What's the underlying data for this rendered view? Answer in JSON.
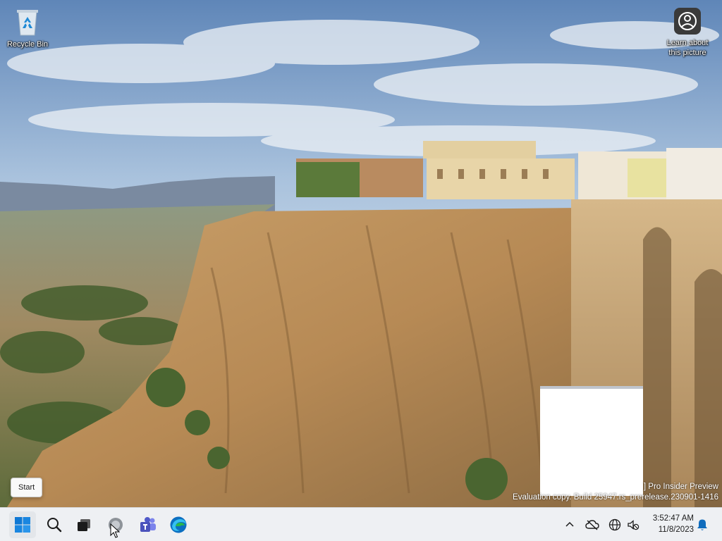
{
  "desktop": {
    "icons": [
      {
        "label": "Recycle Bin",
        "icon": "recycle-bin-icon"
      },
      {
        "label": "Learn about this picture",
        "icon": "info-icon"
      }
    ],
    "watermark": {
      "line1": "] Pro Insider Preview",
      "line2": "Evaluation copy. Build 25947.rs_prerelease.230901-1416"
    }
  },
  "tooltip": {
    "text": "Start"
  },
  "taskbar": {
    "apps": [
      {
        "name": "start",
        "icon": "windows-logo-icon"
      },
      {
        "name": "search",
        "icon": "search-icon"
      },
      {
        "name": "task-view",
        "icon": "task-view-icon"
      },
      {
        "name": "app",
        "icon": "app-icon"
      },
      {
        "name": "teams",
        "icon": "teams-icon"
      },
      {
        "name": "edge",
        "icon": "edge-icon"
      }
    ],
    "tray": {
      "time": "3:52:47 AM",
      "date": "11/8/2023"
    }
  },
  "colors": {
    "accent": "#0067c0",
    "taskbar_bg": "#eef0f3"
  }
}
